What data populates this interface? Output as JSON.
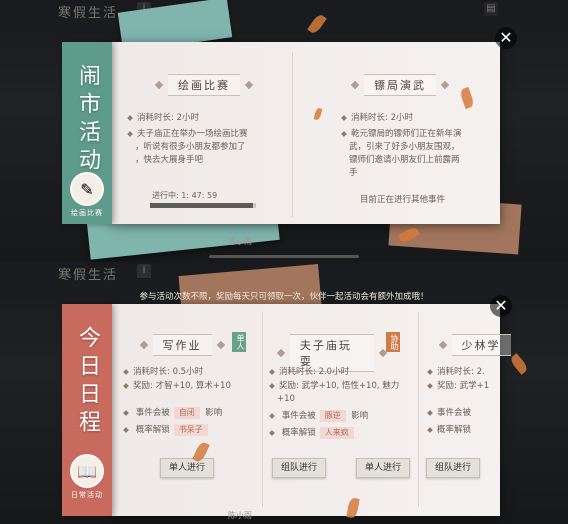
{
  "game_title": "寒假生活",
  "info_icon": "i",
  "top_panel": {
    "banner": {
      "text": "闹市活动",
      "badge_label": "绘画比赛",
      "color": "#5f9b8a"
    },
    "events": [
      {
        "title": "绘画比赛",
        "duration": "消耗时长: 2小时",
        "desc_lines": [
          "夫子庙正在举办一场绘画比赛",
          "，听说有很多小朋友都参加了",
          "，快去大展身手吧"
        ],
        "progress_label": "进行中: 1: 47: 59",
        "progress": 0.97
      },
      {
        "title": "镖局演武",
        "duration": "消耗时长: 2小时",
        "desc_lines": [
          "乾元镖局的镖师们正在新年演",
          "武，引来了好多小朋友围观，",
          "镖师们邀请小朋友们上前露两",
          "手"
        ],
        "footer": "目前正在进行其他事件"
      }
    ],
    "bottom_name": "陈小雨"
  },
  "bottom_panel": {
    "notice": "参与活动次数不限，奖励每天只可领取一次，伙伴一起活动会有额外加成哦！",
    "banner": {
      "text": "今日日程",
      "badge_label": "日常活动",
      "color": "#c96a5e"
    },
    "events": [
      {
        "title": "写作业",
        "tag": "单人",
        "tag_color": "#6aa18a",
        "duration": "消耗时长: 0.5小时",
        "reward": "奖励: 才智+10, 算术+10",
        "affect_label": "事件会被",
        "affect_chip": "自闭",
        "affect_suffix": "影响",
        "unlock_label": "概率解锁",
        "unlock_chip": "书呆子",
        "buttons": [
          "单人进行"
        ]
      },
      {
        "title": "夫子庙玩耍",
        "tag": "协助",
        "tag_color": "#d07a45",
        "duration": "消耗时长: 2.0小时",
        "reward": "奖励: 武学+10, 悟性+10, 魅力",
        "reward2": "+10",
        "affect_label": "事件会被",
        "affect_chip": "豚逆",
        "affect_suffix": "影响",
        "unlock_label": "概率解锁",
        "unlock_chip": "人来疯",
        "buttons": [
          "组队进行",
          "单人进行"
        ]
      },
      {
        "title": "少林学",
        "duration": "消耗时长: 2.",
        "reward": "奖励: 武学+1",
        "affect_label": "事件会被",
        "unlock_label": "概率解锁",
        "buttons": [
          "组队进行"
        ]
      }
    ],
    "bottom_name": "陈小雨"
  },
  "close_icon": "close-icon"
}
